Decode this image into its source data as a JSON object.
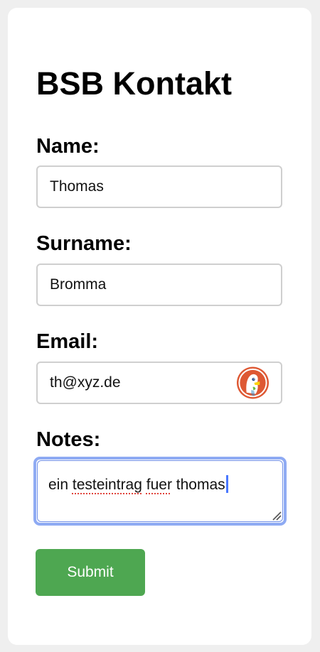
{
  "form": {
    "title": "BSB Kontakt",
    "name": {
      "label": "Name:",
      "value": "Thomas"
    },
    "surname": {
      "label": "Surname:",
      "value": "Bromma"
    },
    "email": {
      "label": "Email:",
      "value": "th@xyz.de"
    },
    "notes": {
      "label": "Notes:",
      "value_part1": "ein ",
      "value_misspelled1": "testeintrag",
      "value_part2": " ",
      "value_misspelled2": "fuer",
      "value_part3": " thomas"
    },
    "submit_label": "Submit"
  },
  "colors": {
    "page_background": "#efefef",
    "card_background": "#ffffff",
    "submit_background": "#4ea751",
    "focus_ring": "#8eaaf3",
    "input_border": "#cfcfcf"
  },
  "icons": {
    "email_autofill": "duckduckgo-logo-icon",
    "textarea_resize": "resize-grip-icon"
  }
}
